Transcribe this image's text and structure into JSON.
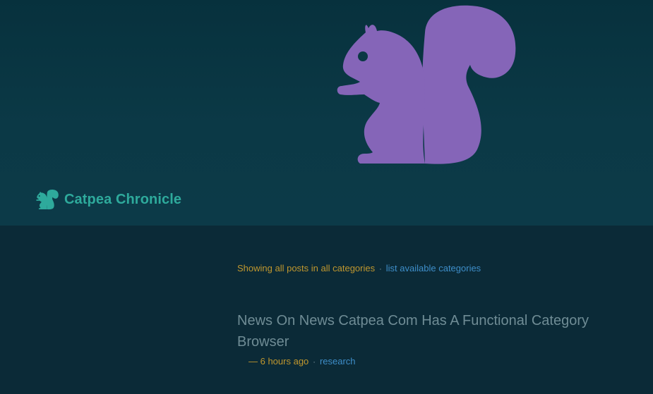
{
  "site": {
    "name": "Catpea Chronicle",
    "logo_icon": "squirrel-icon",
    "brand_color": "#2eaa9c",
    "hero_color": "#8565b8"
  },
  "filter": {
    "status_text": "Showing all posts in all categories",
    "separator": "·",
    "list_link_label": "list available categories"
  },
  "posts": [
    {
      "title": "News On News Catpea Com Has A Functional Category Browser",
      "age": "— 6 hours ago",
      "separator": "·",
      "category": "research"
    }
  ],
  "colors": {
    "background": "#0b2a37",
    "header": "#0b3946",
    "accent_gold": "#c0972e",
    "link_blue": "#3e8ec9",
    "title_gray": "#6f8c95"
  }
}
